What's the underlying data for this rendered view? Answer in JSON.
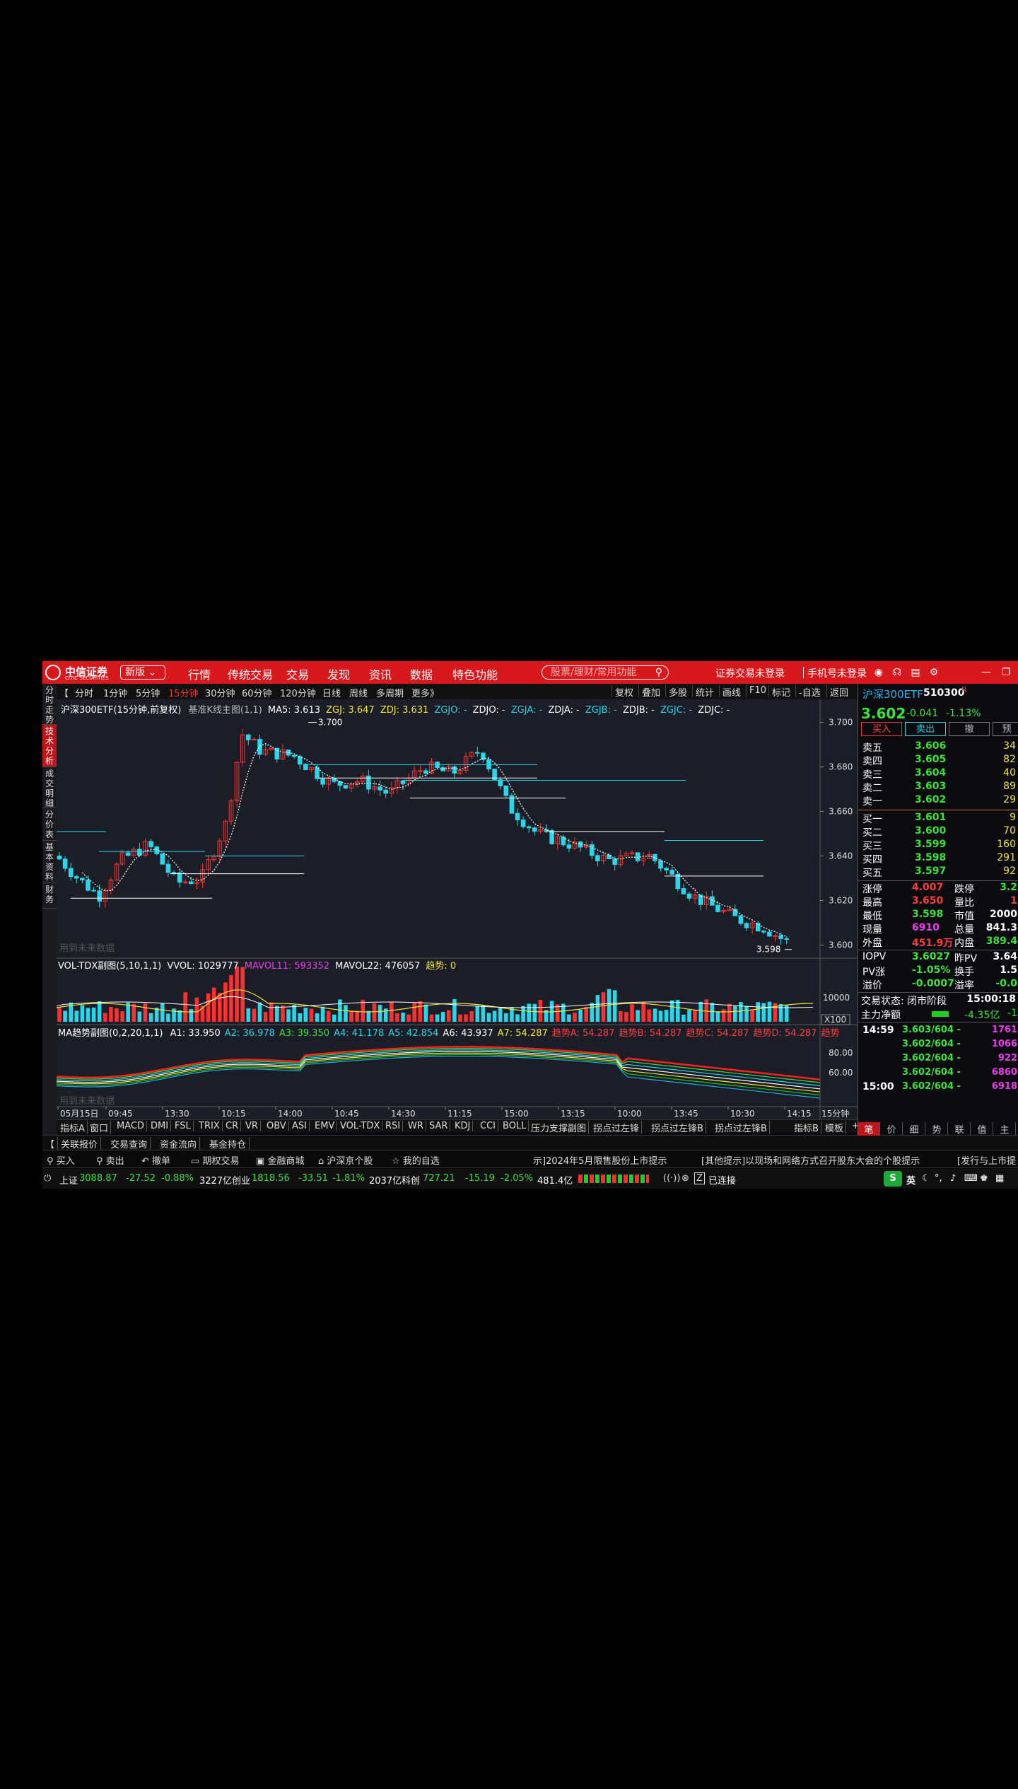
{
  "titlebar": {
    "logo": "中信证券",
    "logo_sub": "CITIC SECURITIES",
    "version_btn": "新版",
    "menu": [
      "行情",
      "传统交易",
      "交易",
      "发现",
      "资讯",
      "数据",
      "特色功能"
    ],
    "search_placeholder": "股票/理财/常用功能",
    "login_status": "证券交易未登录",
    "phone_login": "手机号未登录"
  },
  "left_tabs": [
    "分时走势",
    "技术分析",
    "成交明细",
    "分价表",
    "基本资料",
    "财务"
  ],
  "period_bar": {
    "periods": [
      "分时",
      "1分钟",
      "5分钟",
      "15分钟",
      "30分钟",
      "60分钟",
      "120分钟",
      "日线",
      "周线",
      "多周期",
      "更多》"
    ],
    "active_period": "15分钟",
    "tools": [
      "复权",
      "叠加",
      "多股",
      "统计",
      "画线",
      "F10",
      "标记",
      "-自选",
      "返回"
    ]
  },
  "main_header": {
    "name": "沪深300ETF(15分钟,前复权)",
    "indicator": "基准K线主图(1,1)",
    "ma5": "MA5: 3.613",
    "zgj": "ZGJ: 3.647",
    "zdj": "ZDJ: 3.631",
    "rest": [
      "ZGJO: -",
      "ZDJO: -",
      "ZGJA: -",
      "ZDJA: -",
      "ZGJB: -",
      "ZDJB: -",
      "ZGJC: -",
      "ZDJC: -"
    ]
  },
  "vol_header": {
    "name": "VOL-TDX副图(5,10,1,1)",
    "vvol": "VVOL: 1029777",
    "mavol11": "MAVOL11: 593352",
    "mavol22": "MAVOL22: 476057",
    "trend": "趋势: 0",
    "unit": "X100"
  },
  "ma_header": {
    "name": "MA趋势副图(0,2,20,1,1)",
    "values": [
      {
        "t": "A1: 33.950",
        "c": "#ffffff"
      },
      {
        "t": "A2: 36.978",
        "c": "#29d5e8"
      },
      {
        "t": "A3: 39.350",
        "c": "#3be23b"
      },
      {
        "t": "A4: 41.178",
        "c": "#29d5e8"
      },
      {
        "t": "A5: 42.854",
        "c": "#29d5e8"
      },
      {
        "t": "A6: 43.937",
        "c": "#ffffff"
      },
      {
        "t": "A7: 54.287",
        "c": "#f3e63a"
      },
      {
        "t": "趋势A: 54.287",
        "c": "#ff3d3d"
      },
      {
        "t": "趋势B: 54.287",
        "c": "#ff3d3d"
      },
      {
        "t": "趋势C: 54.287",
        "c": "#ff3d3d"
      },
      {
        "t": "趋势D: 54.287",
        "c": "#ff3d3d"
      },
      {
        "t": "趋势",
        "c": "#ff3d3d"
      }
    ]
  },
  "watermark": "用到未来数据",
  "price_axis": [
    "3.700",
    "3.680",
    "3.660",
    "3.640",
    "3.620",
    "3.600"
  ],
  "vol_axis": [
    "10000"
  ],
  "ma_axis": [
    "80.00",
    "60.00"
  ],
  "high_label": "3.700",
  "low_label": "3.598",
  "time_axis": [
    "05月15日",
    "09:45",
    "13:30",
    "10:15",
    "14:00",
    "10:45",
    "14:30",
    "11:15",
    "15:00",
    "13:15",
    "10:00",
    "13:45",
    "10:30",
    "14:15"
  ],
  "period_label": "15分钟",
  "indicator_tabs": [
    "指标A",
    "窗口",
    "MACD",
    "DMI",
    "FSL",
    "TRIX",
    "CR",
    "VR",
    "OBV",
    "ASI",
    "EMV",
    "VOL-TDX",
    "RSI",
    "WR",
    "SAR",
    "KDJ",
    "CCI",
    "BOLL",
    "压力支撑副图",
    "拐点过左锋",
    "拐点过左锋B",
    "拐点过左锋B"
  ],
  "indicator_tabs_right": [
    "指标B",
    "模板",
    "+"
  ],
  "page_tabs": [
    "关联报价",
    "交易查询",
    "资金流向",
    "基金持仓"
  ],
  "trade_bar": {
    "items": [
      "买入",
      "卖出",
      "撤单",
      "期权交易",
      "金融商城",
      "沪深京个股",
      "我的自选"
    ],
    "news1": "示]2024年5月限售股份上市提示",
    "news2": "[其他提示]以现场和网络方式召开股东大会的个股提示",
    "news3": "[发行与上市提"
  },
  "status_bar": {
    "sh_label": "上证",
    "sh_val": "3088.87",
    "sh_chg": "-27.52",
    "sh_pct": "-0.88%",
    "sh_amt": "3227亿",
    "cy_label": "创业",
    "cy_val": "1818.56",
    "cy_chg": "-33.51",
    "cy_pct": "-1.81%",
    "cy_amt": "2037亿",
    "kc_label": "科创",
    "kc_val": "727.21",
    "kc_chg": "-15.19",
    "kc_pct": "-2.05%",
    "kc_amt": "481.4亿",
    "conn": "已连接",
    "ime": "英"
  },
  "quote": {
    "name": "沪深300ETF",
    "code": "510300",
    "flag": "R",
    "price": "3.602",
    "chg": "-0.041",
    "pct": "-1.13%",
    "buttons": [
      "买入",
      "卖出",
      "撤",
      "预"
    ],
    "sells": [
      {
        "label": "卖五",
        "price": "3.606",
        "vol": "34"
      },
      {
        "label": "卖四",
        "price": "3.605",
        "vol": "82"
      },
      {
        "label": "卖三",
        "price": "3.604",
        "vol": "40"
      },
      {
        "label": "卖二",
        "price": "3.603",
        "vol": "89"
      },
      {
        "label": "卖一",
        "price": "3.602",
        "vol": "29"
      }
    ],
    "buys": [
      {
        "label": "买一",
        "price": "3.601",
        "vol": "9"
      },
      {
        "label": "买二",
        "price": "3.600",
        "vol": "70"
      },
      {
        "label": "买三",
        "price": "3.599",
        "vol": "160"
      },
      {
        "label": "买四",
        "price": "3.598",
        "vol": "291"
      },
      {
        "label": "买五",
        "price": "3.597",
        "vol": "92"
      }
    ],
    "stats": [
      {
        "l1": "涨停",
        "v1": "4.007",
        "c1": "#ff3d3d",
        "l2": "跌停",
        "v2": "3.2",
        "c2": "#3be23b"
      },
      {
        "l1": "最高",
        "v1": "3.650",
        "c1": "#ff3d3d",
        "l2": "量比",
        "v2": "1",
        "c2": "#ff3d3d"
      },
      {
        "l1": "最低",
        "v1": "3.598",
        "c1": "#3be23b",
        "l2": "市值",
        "v2": "2000",
        "c2": "#ffffff"
      },
      {
        "l1": "现量",
        "v1": "6910",
        "c1": "#e93ce9",
        "l2": "总量",
        "v2": "841.3",
        "c2": "#ffffff"
      },
      {
        "l1": "外盘",
        "v1": "451.9万",
        "c1": "#ff3d3d",
        "l2": "内盘",
        "v2": "389.4",
        "c2": "#3be23b"
      }
    ],
    "iopv": [
      {
        "l1": "IOPV",
        "v1": "3.6027",
        "c1": "#3be23b",
        "l2": "昨PV",
        "v2": "3.64",
        "c2": "#ffffff"
      },
      {
        "l1": "PV涨",
        "v1": "-1.05%",
        "c1": "#3be23b",
        "l2": "换手",
        "v2": "1.5",
        "c2": "#ffffff"
      },
      {
        "l1": "溢价",
        "v1": "-0.0007",
        "c1": "#3be23b",
        "l2": "溢率",
        "v2": "-0.0",
        "c2": "#3be23b"
      }
    ],
    "trade_status": "交易状态: 闭市阶段",
    "trade_time": "15:00:18",
    "main_flow_label": "主力净额",
    "main_flow_val": "-4.35亿",
    "main_flow_val2": "-1",
    "ticks": [
      {
        "time": "14:59",
        "price": "3.603/604 -",
        "vol": "1761"
      },
      {
        "time": "",
        "price": "3.602/604 -",
        "vol": "1066"
      },
      {
        "time": "",
        "price": "3.602/604 -",
        "vol": "922"
      },
      {
        "time": "",
        "price": "3.602/604 -",
        "vol": "6860"
      },
      {
        "time": "15:00",
        "price": "3.602/604 -",
        "vol": "6918"
      }
    ],
    "bottom_tabs": [
      "笔",
      "价",
      "细",
      "势",
      "联",
      "值",
      "主"
    ]
  },
  "colors": {
    "up": "#ff3030",
    "down": "#29d5e8",
    "bg": "#1b1d27",
    "titlebar": "#d7181d"
  }
}
